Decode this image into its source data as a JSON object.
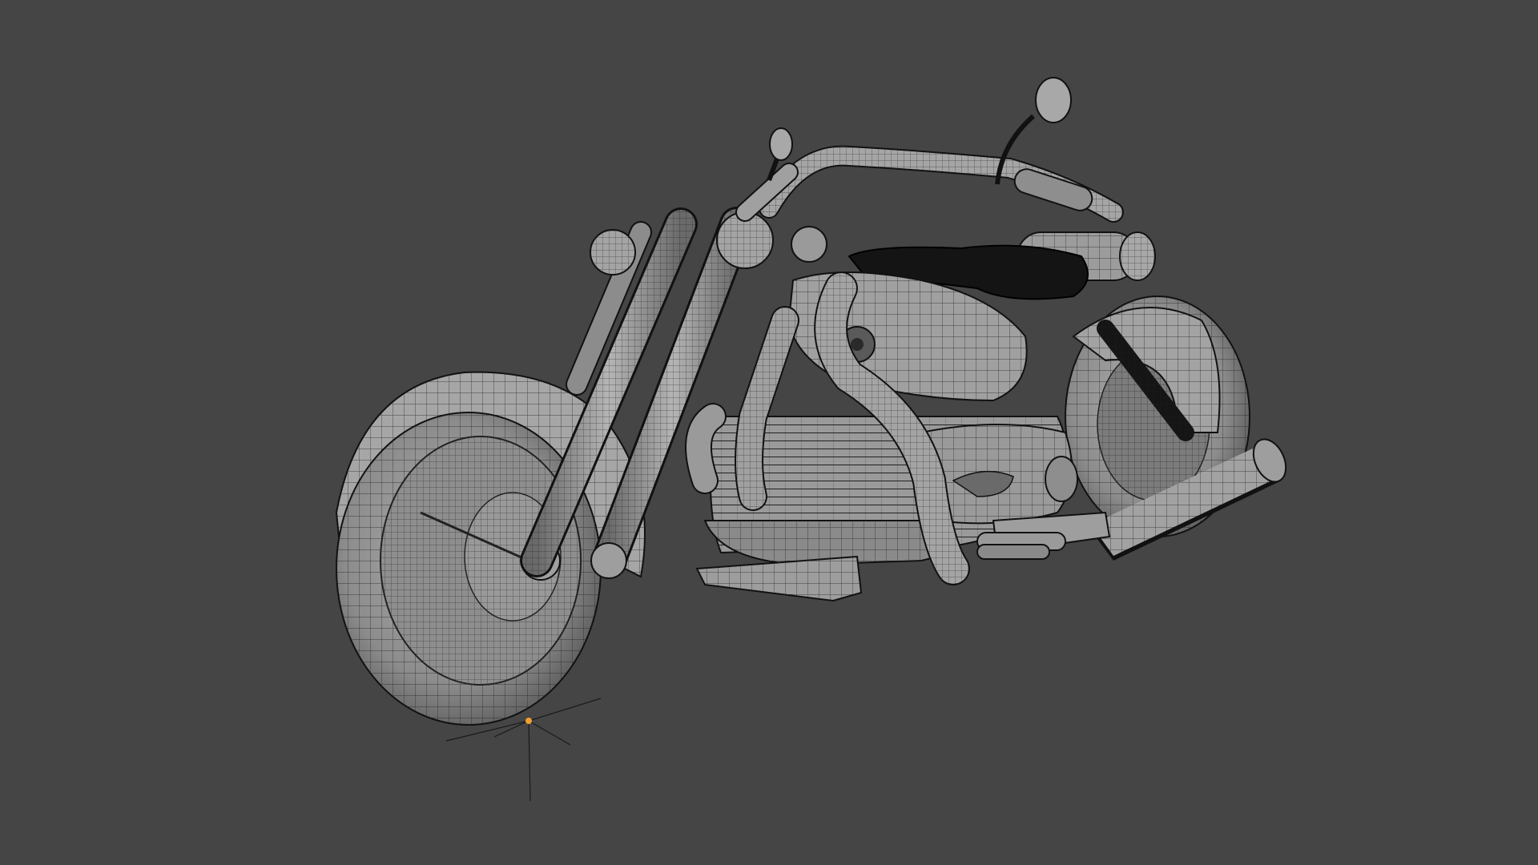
{
  "viewport": {
    "background_color": "#454545",
    "mesh_fill": "#8a8a8a",
    "mesh_fill_light": "#a6a6a6",
    "mesh_fill_dark": "#5e5e5e",
    "wire_color": "#1e1e1e",
    "seat_color": "#141414",
    "origin_point_color": "#f0a030"
  },
  "scene": {
    "object": "motorcycle-wireframe-mesh",
    "shading": "solid-with-wireframe-overlay"
  }
}
